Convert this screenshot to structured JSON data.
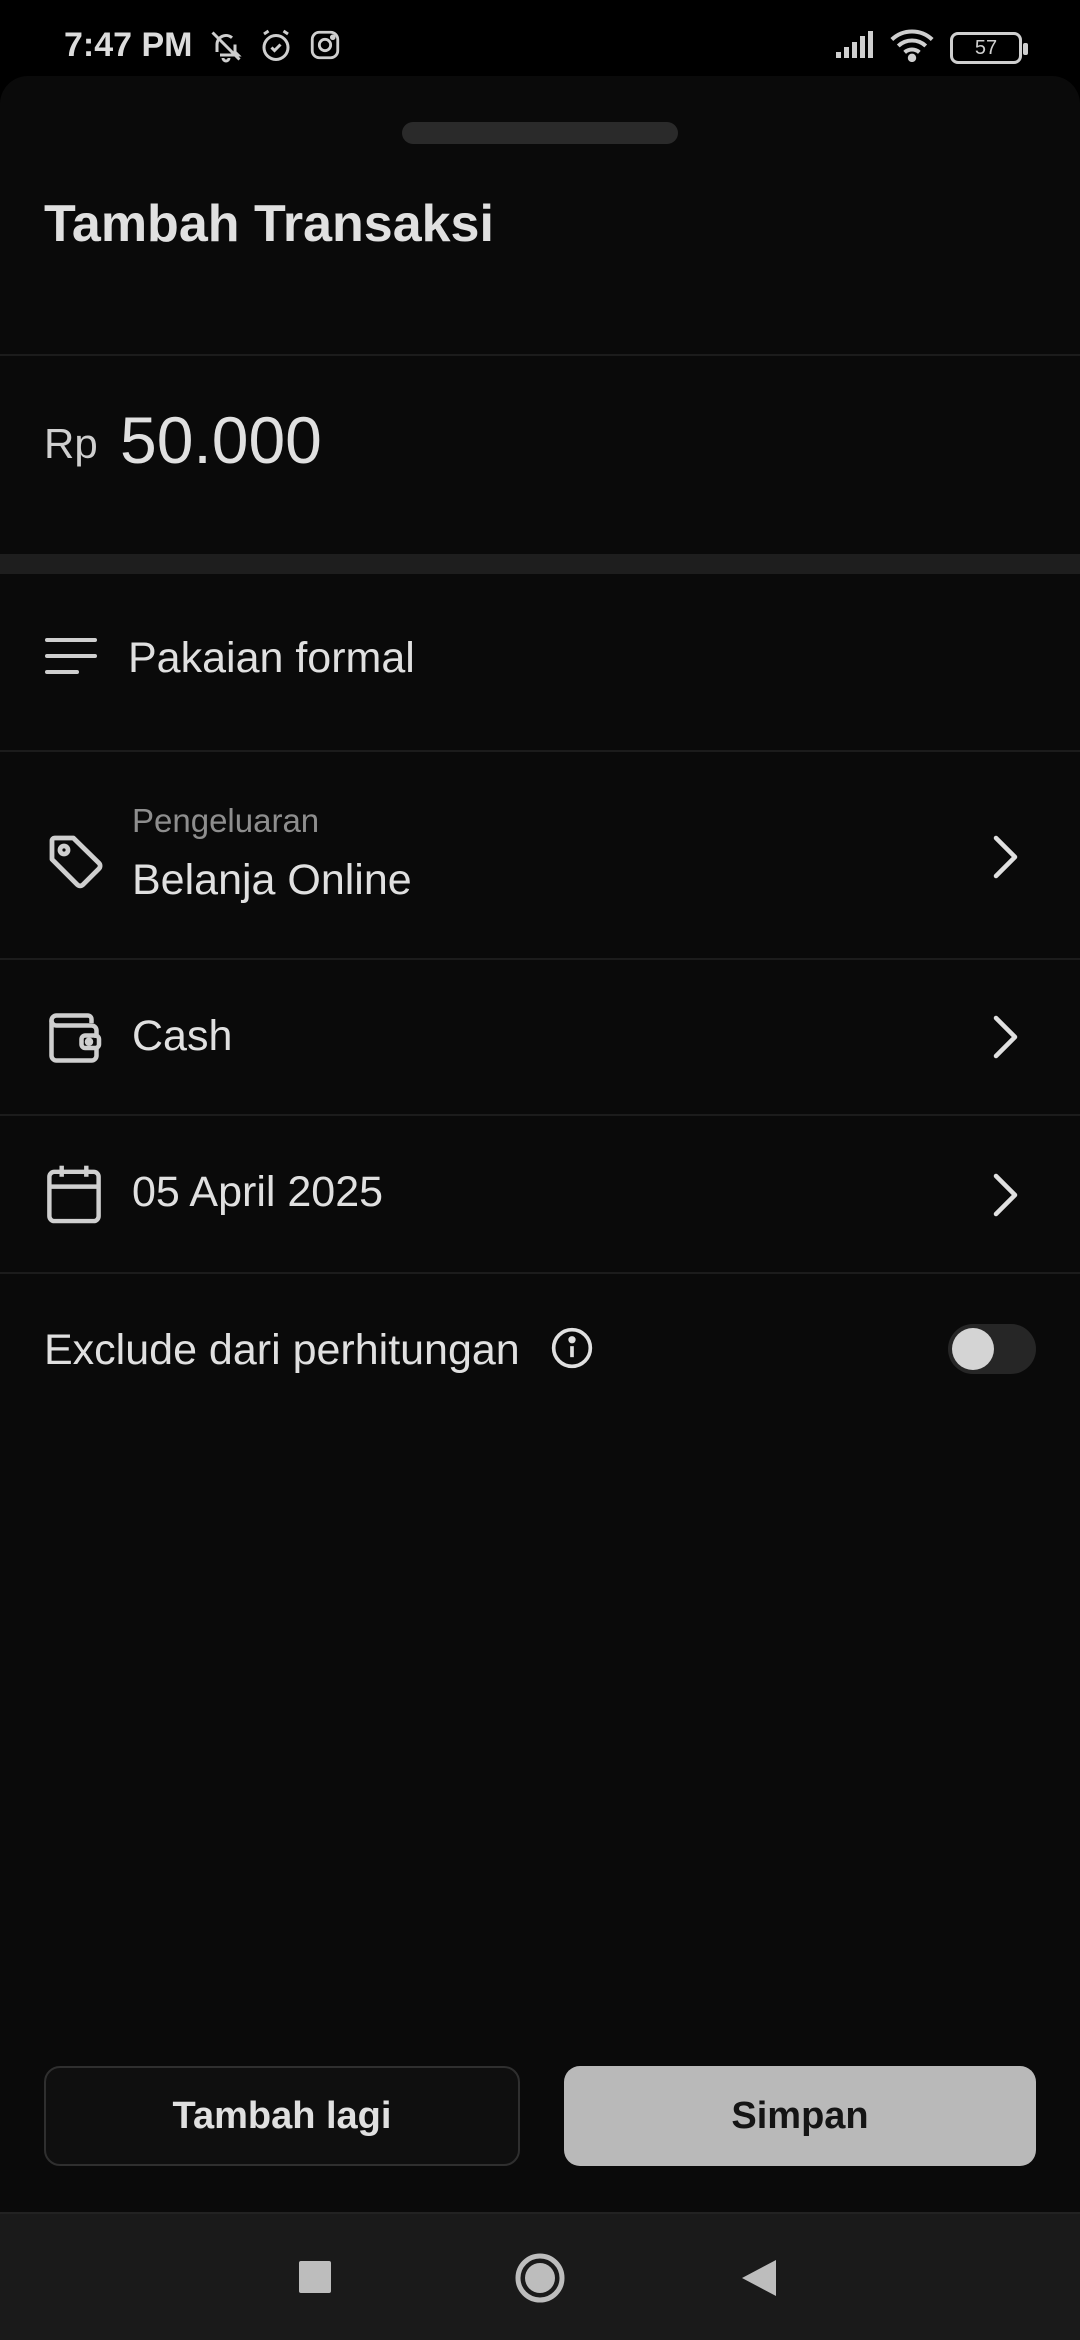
{
  "status_bar": {
    "time": "7:47 PM",
    "battery": "57"
  },
  "sheet": {
    "title": "Tambah Transaksi"
  },
  "amount": {
    "currency": "Rp",
    "value": "50.000"
  },
  "fields": {
    "note": "Pakaian formal",
    "category_type": "Pengeluaran",
    "category": "Belanja Online",
    "wallet": "Cash",
    "date": "05 April 2025",
    "exclude_label": "Exclude dari perhitungan",
    "exclude_enabled": false
  },
  "buttons": {
    "add_more": "Tambah lagi",
    "save": "Simpan"
  },
  "icons": {
    "notes": "notes-lines-icon",
    "category": "tag-icon",
    "wallet": "wallet-icon",
    "date": "calendar-icon",
    "info": "info-icon",
    "chevron": "chevron-right-icon"
  }
}
